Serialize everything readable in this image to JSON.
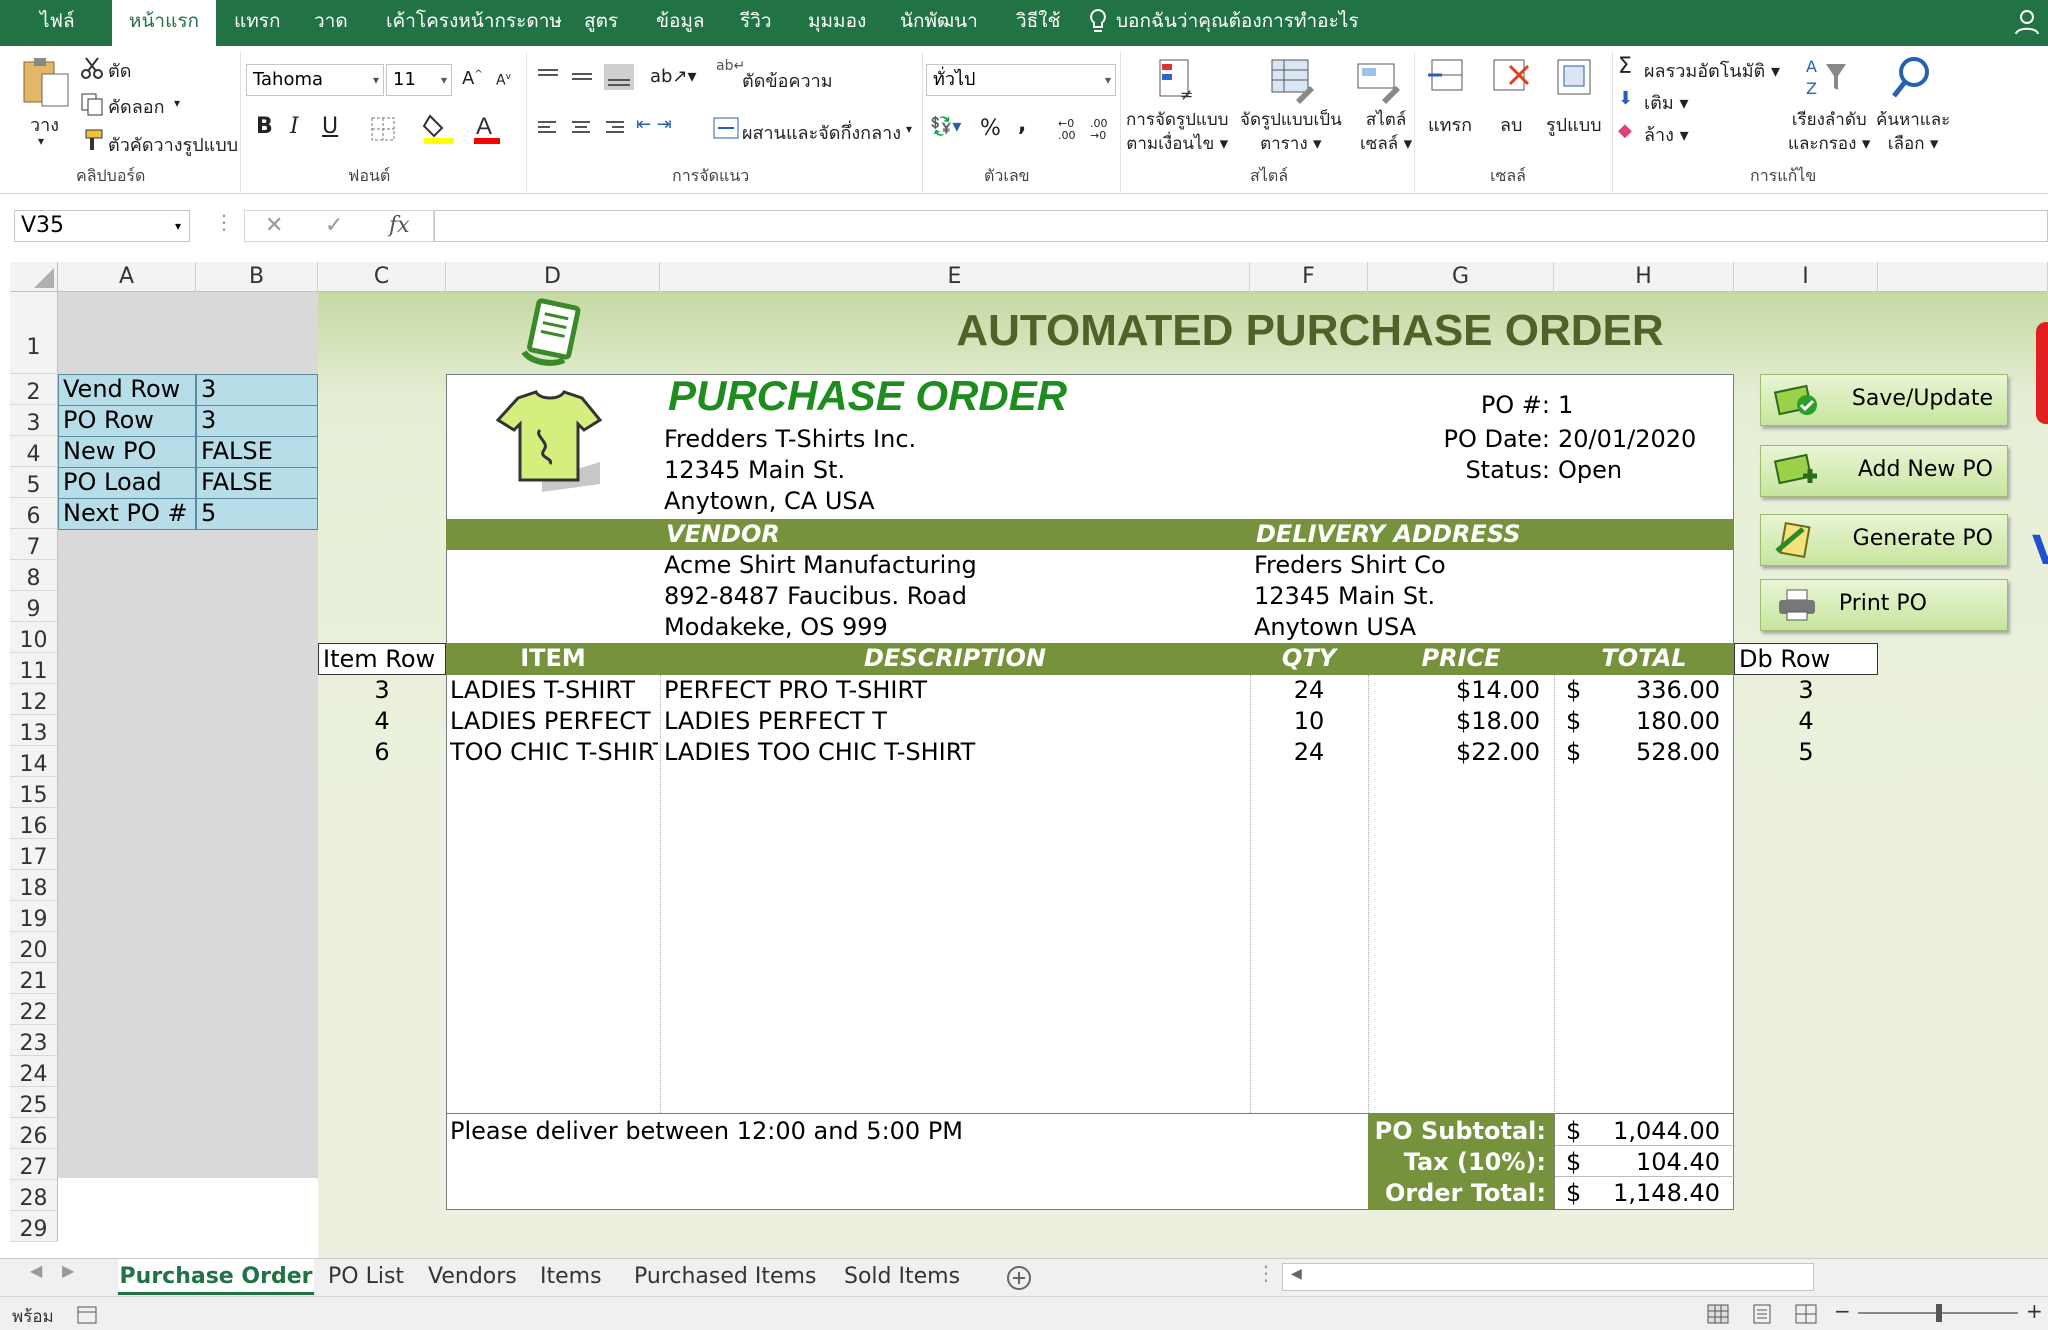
{
  "menu": {
    "tabs": [
      "ไฟล์",
      "หน้าแรก",
      "แทรก",
      "วาด",
      "เค้าโครงหน้ากระดาษ",
      "สูตร",
      "ข้อมูล",
      "รีวิว",
      "มุมมอง",
      "นักพัฒนา",
      "วิธีใช้"
    ],
    "active": "หน้าแรก",
    "tell_me": "บอกฉันว่าคุณต้องการทำอะไร"
  },
  "ribbon": {
    "clipboard": {
      "paste": "วาง",
      "cut": "ตัด",
      "copy": "คัดลอก",
      "format_painter": "ตัวคัดวางรูปแบบ",
      "group": "คลิปบอร์ด"
    },
    "font": {
      "name": "Tahoma",
      "size": "11",
      "bold": "B",
      "italic": "I",
      "underline": "U",
      "group": "ฟอนต์"
    },
    "alignment": {
      "wrap": "ตัดข้อความ",
      "merge": "ผสานและจัดกึ่งกลาง",
      "group": "การจัดแนว"
    },
    "number": {
      "format": "ทั่วไป",
      "percent": "%",
      "comma": ",",
      "group": "ตัวเลข"
    },
    "styles": {
      "conditional_1": "การจัดรูปแบบ",
      "conditional_2": "ตามเงื่อนไข",
      "table_1": "จัดรูปแบบเป็น",
      "table_2": "ตาราง",
      "cell_1": "สไตล์",
      "cell_2": "เซลล์",
      "group": "สไตล์"
    },
    "cells": {
      "insert": "แทรก",
      "delete": "ลบ",
      "format": "รูปแบบ",
      "group": "เซลล์"
    },
    "editing": {
      "autosum": "ผลรวมอัตโนมัติ",
      "fill": "เติม",
      "clear": "ล้าง",
      "sort_1": "เรียงลำดับ",
      "sort_2": "และกรอง",
      "find_1": "ค้นหาและ",
      "find_2": "เลือก",
      "group": "การแก้ไข"
    }
  },
  "formula_bar": {
    "name_box": "V35",
    "fx": "fx",
    "content": ""
  },
  "columns": [
    "A",
    "B",
    "C",
    "D",
    "E",
    "F",
    "G",
    "H",
    "I"
  ],
  "rows": [
    "1",
    "2",
    "3",
    "4",
    "5",
    "6",
    "7",
    "8",
    "9",
    "10",
    "11",
    "12",
    "13",
    "14",
    "15",
    "16",
    "17",
    "18",
    "19",
    "20",
    "21",
    "22",
    "23",
    "24",
    "25",
    "26",
    "27",
    "28",
    "29"
  ],
  "sidebar": [
    {
      "label": "Vend Row",
      "value": "3"
    },
    {
      "label": "PO Row",
      "value": "3"
    },
    {
      "label": "New PO",
      "value": "FALSE"
    },
    {
      "label": "PO Load",
      "value": "FALSE"
    },
    {
      "label": "Next PO #",
      "value": "5"
    }
  ],
  "banner_title": "AUTOMATED PURCHASE ORDER",
  "po": {
    "heading": "PURCHASE ORDER",
    "company": [
      "Fredders T-Shirts Inc.",
      "12345 Main St.",
      "Anytown, CA USA"
    ],
    "po_num_label": "PO #:",
    "po_num": "1",
    "date_label": "PO Date:",
    "date": "20/01/2020",
    "status_label": "Status:",
    "status": "Open",
    "vendor_hdr": "VENDOR",
    "delivery_hdr": "DELIVERY ADDRESS",
    "vendor": [
      "Acme Shirt Manufacturing",
      "892-8487 Faucibus. Road",
      "Modakeke, OS 999"
    ],
    "delivery": [
      "Freders Shirt Co",
      "12345 Main St.",
      "Anytown USA"
    ],
    "item_row_label": "Item Row",
    "db_row_label": "Db Row",
    "headers": {
      "item": "ITEM",
      "desc": "DESCRIPTION",
      "qty": "QTY",
      "price": "PRICE",
      "total": "TOTAL"
    },
    "items": [
      {
        "row": "3",
        "item": "LADIES T-SHIRT",
        "desc": "PERFECT PRO T-SHIRT",
        "qty": "24",
        "price": "$14.00",
        "cur": "$",
        "total": "336.00",
        "db": "3"
      },
      {
        "row": "4",
        "item": "LADIES PERFECT T",
        "desc": "LADIES PERFECT T",
        "qty": "10",
        "price": "$18.00",
        "cur": "$",
        "total": "180.00",
        "db": "4"
      },
      {
        "row": "6",
        "item": "TOO CHIC T-SHIRT",
        "desc": "LADIES TOO CHIC T-SHIRT",
        "qty": "24",
        "price": "$22.00",
        "cur": "$",
        "total": "528.00",
        "db": "5"
      }
    ],
    "note": "Please deliver between 12:00 and 5:00 PM",
    "subtotal_label": "PO Subtotal:",
    "subtotal": "1,044.00",
    "tax_label": "Tax (10%):",
    "tax": "104.40",
    "order_total_label": "Order Total:",
    "order_total": "1,148.40",
    "currency": "$"
  },
  "buttons": {
    "save": "Save/Update",
    "add": "Add New PO",
    "generate": "Generate PO",
    "print": "Print PO"
  },
  "sheet_tabs": [
    "Purchase Order",
    "PO List",
    "Vendors",
    "Items",
    "Purchased Items",
    "Sold Items"
  ],
  "active_sheet": "Purchase Order",
  "status_text": "พร้อม",
  "colors": {
    "excel_green": "#217346",
    "po_green": "#76923c",
    "banner_text": "#4f6228",
    "heading_green": "#1e8c1e",
    "sidebar_blue": "#b7dde8"
  }
}
